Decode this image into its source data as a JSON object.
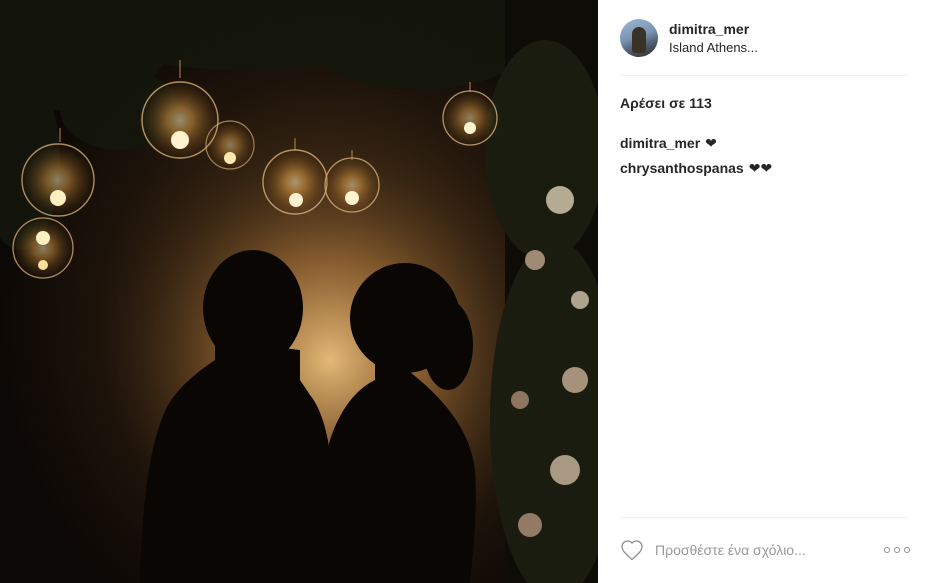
{
  "post": {
    "photo": {
      "icon": "wedding-couple-silhouette-photo"
    },
    "header": {
      "username": "dimitra_mer",
      "location": "Island Athens..."
    },
    "likes": {
      "label": "Αρέσει σε 113"
    },
    "comments": [
      {
        "user": "dimitra_mer",
        "text": "❤"
      },
      {
        "user": "chrysanthospanas",
        "text": "❤❤"
      }
    ],
    "footer": {
      "like_icon": "heart-outline-icon",
      "comment_placeholder": "Προσθέστε ένα σχόλιο...",
      "more_icon": "more-options-icon"
    }
  }
}
